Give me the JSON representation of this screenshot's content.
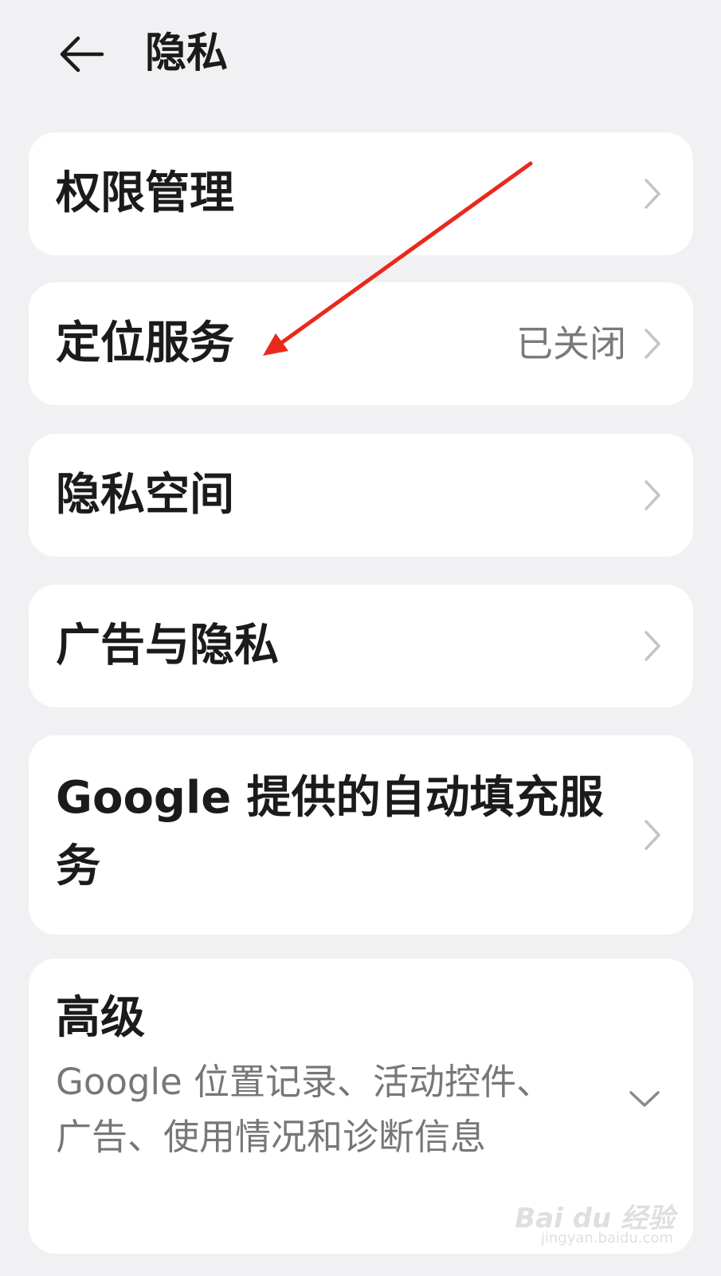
{
  "header": {
    "title": "隐私",
    "back_icon": "arrow-left-icon"
  },
  "items": [
    {
      "label": "权限管理",
      "value": ""
    },
    {
      "label": "定位服务",
      "value": "已关闭"
    },
    {
      "label": "隐私空间",
      "value": ""
    },
    {
      "label": "广告与隐私",
      "value": ""
    },
    {
      "label": "Google 提供的自动填充服务",
      "value": ""
    }
  ],
  "advanced": {
    "label": "高级",
    "description": "Google 位置记录、活动控件、广告、使用情况和诊断信息"
  },
  "annotation": {
    "color": "#e8291c"
  },
  "watermark": {
    "logo": "Bai du 经验",
    "sub": "jingyan.baidu.com"
  }
}
